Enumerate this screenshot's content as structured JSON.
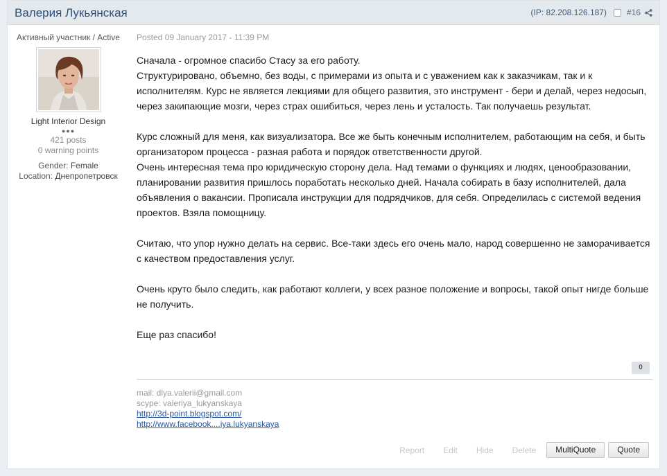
{
  "author": {
    "name": "Валерия Лукьянская"
  },
  "header": {
    "ip": "(IP: 82.208.126.187)",
    "post_number": "#16"
  },
  "sidebar": {
    "member_title": "Активный участник / Active",
    "rank_title": "Light Interior Design",
    "rank_pips": "●●●",
    "post_count": "421 posts",
    "warning_points": "0 warning points",
    "gender_label": "Gender:",
    "gender_value": "Female",
    "location_label": "Location:",
    "location_value": "Днепропетровск"
  },
  "post": {
    "date": "Posted 09 January 2017 - 11:39 PM",
    "paragraphs": [
      "Сначала - огромное спасибо Стасу за его работу.\nСтруктурировано, объемно, без воды, с примерами из опыта и с уважением как к заказчикам, так и к исполнителям. Курс не является лекциями для общего развития, это инструмент - бери и делай, через недосып, через закипающие мозги, через страх ошибиться, через лень и усталость. Так получаешь результат.",
      "Курс сложный для меня, как визуализатора. Все же быть конечным исполнителем, работающим на себя, и быть организатором процесса - разная работа и порядок ответственности другой.\nОчень интересная тема про юридическую сторону дела. Над темами о функциях и людях, ценообразовании, планировании развития пришлось поработать несколько дней.  Начала собирать в базу исполнителей, дала объявления о вакансии. Прописала инструкции для подрядчиков, для себя. Определилась с системой ведения проектов. Взяла помощницу.",
      "Считаю, что упор нужно делать на сервис. Все-таки здесь его очень мало, народ совершенно не заморачивается с качеством предоставления услуг.",
      "Очень круто было следить, как работают коллеги, у всех разное положение и вопросы, такой опыт нигде больше не получить.",
      "Еще раз спасибо!"
    ],
    "reputation": "0"
  },
  "signature": {
    "mail": "mail: dlya.valerii@gmail.com",
    "skype": "scype: valeriya_lukyanskaya",
    "link1": "http://3d-point.blogspot.com/",
    "link2": "http://www.facebook....iya.lukyanskaya"
  },
  "controls": {
    "report": "Report",
    "edit": "Edit",
    "hide": "Hide",
    "delete": "Delete",
    "multiquote": "MultiQuote",
    "quote": "Quote"
  },
  "colors": {
    "author_name": "#2b4f7c",
    "header_bg": "#e4e9ee",
    "link": "#2757a6",
    "page_bg": "#ebeef2"
  },
  "icons": {
    "share": "share-icon",
    "select": "checkbox-icon"
  }
}
